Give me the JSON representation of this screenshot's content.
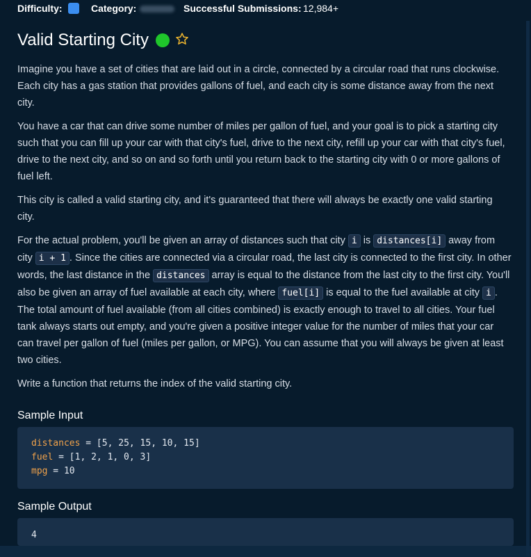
{
  "meta": {
    "difficulty_label": "Difficulty:",
    "difficulty_color": "#3b8ef0",
    "category_label": "Category:",
    "submissions_label": "Successful Submissions:",
    "submissions_value": "12,984+"
  },
  "problem": {
    "title": "Valid Starting City",
    "status_color": "#1fc62b",
    "favorite_icon": "star-outline-icon"
  },
  "description": {
    "p1": "Imagine you have a set of cities that are laid out in a circle, connected by a circular road that runs clockwise. Each city has a gas station that provides gallons of fuel, and each city is some distance away from the next city.",
    "p2": "You have a car that can drive some number of miles per gallon of fuel, and your goal is to pick a starting city such that you can fill up your car with that city's fuel, drive to the next city, refill up your car with that city's fuel, drive to the next city, and so on and so forth until you return back to the starting city with 0 or more gallons of fuel left.",
    "p3": "This city is called a valid starting city, and it's guaranteed that there will always be exactly one valid starting city.",
    "p4": {
      "t1": "For the actual problem, you'll be given an array of distances such that city ",
      "c1": "i",
      "t2": " is ",
      "c2": "distances[i]",
      "t3": " away from city ",
      "c3": "i + 1",
      "t4": ". Since the cities are connected via a circular road, the last city is connected to the first city. In other words, the last distance in the ",
      "c4": "distances",
      "t5": " array is equal to the distance from the last city to the first city. You'll also be given an array of fuel available at each city, where ",
      "c5": "fuel[i]",
      "t6": " is equal to the fuel available at city ",
      "c6": "i",
      "t7": ". The total amount of fuel available (from all cities combined) is exactly enough to travel to all cities. Your fuel tank always starts out empty, and you're given a positive integer value for the number of miles that your car can travel per gallon of fuel (miles per gallon, or MPG). You can assume that you will always be given at least two cities."
    },
    "p5": "Write a function that returns the index of the valid starting city."
  },
  "sample_input": {
    "title": "Sample Input",
    "lines": [
      {
        "var": "distances",
        "rest": " = [5, 25, 15, 10, 15]"
      },
      {
        "var": "fuel",
        "rest": " = [1, 2, 1, 0, 3]"
      },
      {
        "var": "mpg",
        "rest": " = 10"
      }
    ]
  },
  "sample_output": {
    "title": "Sample Output",
    "value": "4"
  }
}
